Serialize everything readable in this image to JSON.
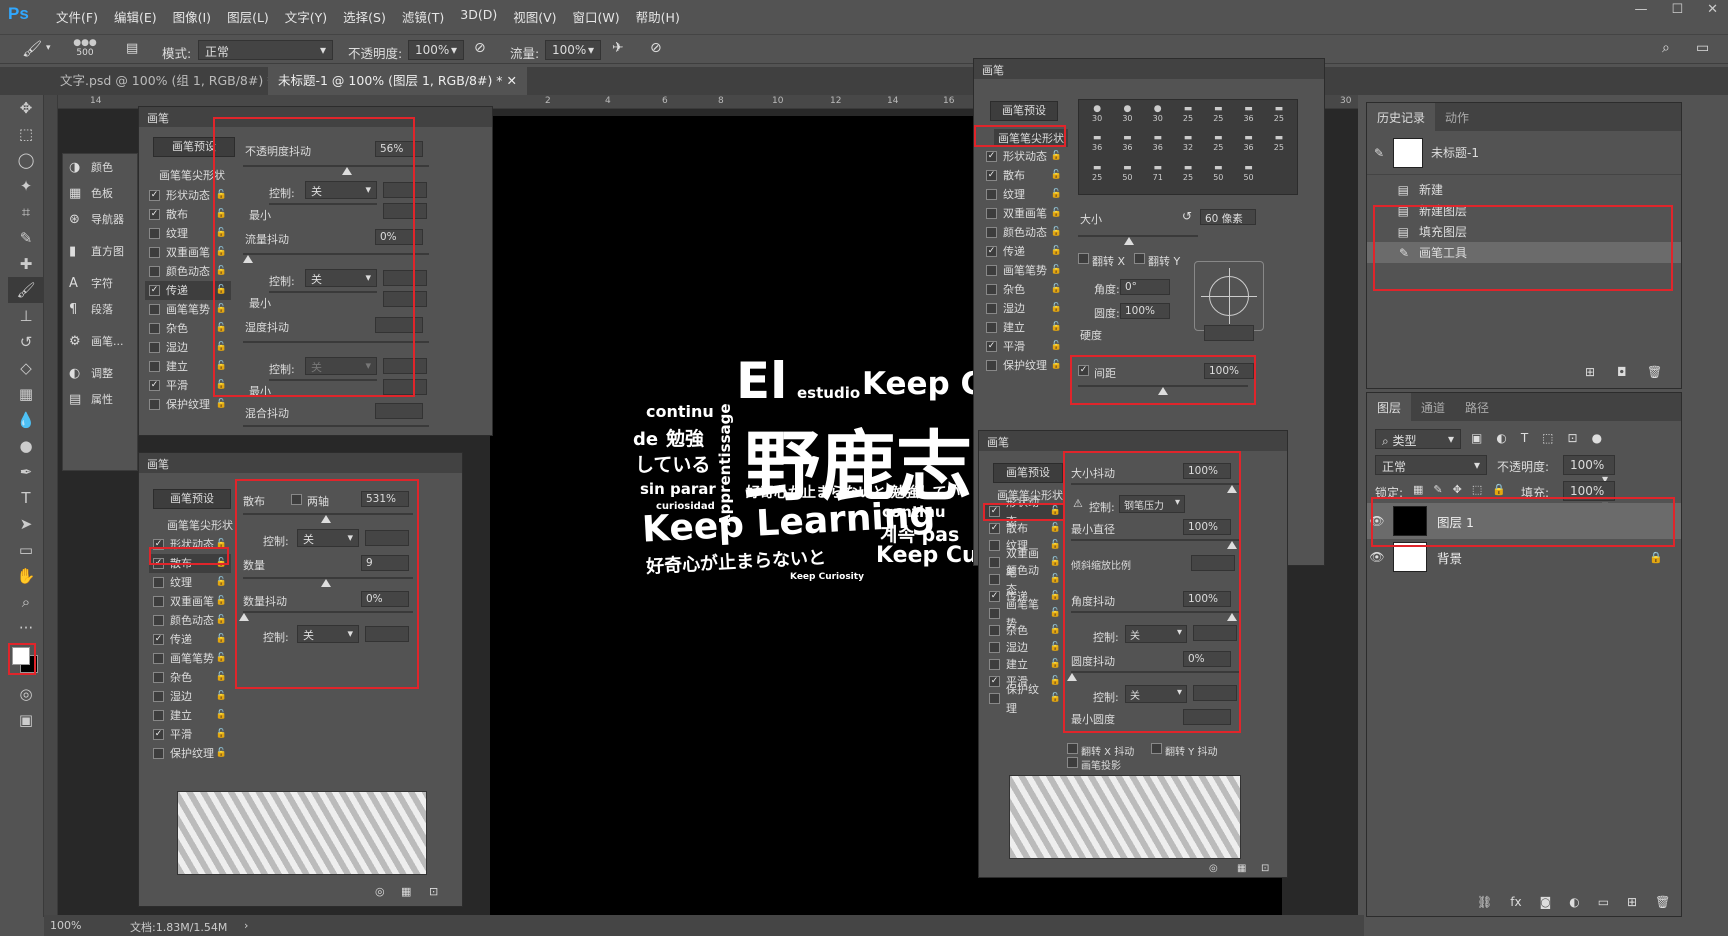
{
  "menubar": {
    "logo": "Ps",
    "items": [
      "文件(F)",
      "编辑(E)",
      "图像(I)",
      "图层(L)",
      "文字(Y)",
      "选择(S)",
      "滤镜(T)",
      "3D(D)",
      "视图(V)",
      "窗口(W)",
      "帮助(H)"
    ]
  },
  "options": {
    "brush_size": "500",
    "mode_label": "模式:",
    "mode_value": "正常",
    "opacity_label": "不透明度:",
    "opacity_value": "100%",
    "flow_label": "流量:",
    "flow_value": "100%"
  },
  "tabs": [
    {
      "label": "文字.psd @ 100% (组 1, RGB/8#) *",
      "active": false
    },
    {
      "label": "未标题-1 @ 100% (图层 1, RGB/8#) *",
      "active": true
    }
  ],
  "ruler_h": [
    "14",
    "2",
    "4",
    "6",
    "8",
    "10",
    "12",
    "14",
    "16",
    "30",
    "42"
  ],
  "ruler_v": [
    "1",
    "1",
    "1",
    "1",
    "1",
    "1",
    "2",
    "2",
    "2",
    "2",
    "2",
    "3",
    "3",
    "3"
  ],
  "mini_panels": [
    {
      "label": "颜色",
      "icon": "color-icon"
    },
    {
      "label": "色板",
      "icon": "swatches-icon"
    },
    {
      "label": "导航器",
      "icon": "navigator-icon"
    },
    {
      "label": "直方图",
      "icon": "histogram-icon"
    },
    {
      "label": "字符",
      "icon": "character-icon"
    },
    {
      "label": "段落",
      "icon": "paragraph-icon"
    },
    {
      "label": "画笔...",
      "icon": "brush-settings-icon"
    },
    {
      "label": "调整",
      "icon": "adjustments-icon"
    },
    {
      "label": "属性",
      "icon": "properties-icon"
    }
  ],
  "brush_panel": {
    "title": "画笔",
    "presets_button": "画笔预设",
    "tip_shape": "画笔笔尖形状",
    "options": [
      {
        "label": "形状动态",
        "checked": true
      },
      {
        "label": "散布",
        "checked": true
      },
      {
        "label": "纹理",
        "checked": false
      },
      {
        "label": "双重画笔",
        "checked": false
      },
      {
        "label": "颜色动态",
        "checked": false
      },
      {
        "label": "传递",
        "checked": true
      },
      {
        "label": "画笔笔势",
        "checked": false
      },
      {
        "label": "杂色",
        "checked": false
      },
      {
        "label": "湿边",
        "checked": false
      },
      {
        "label": "建立",
        "checked": false
      },
      {
        "label": "平滑",
        "checked": true
      },
      {
        "label": "保护纹理",
        "checked": false
      }
    ]
  },
  "transfer": {
    "opacity_jitter_label": "不透明度抖动",
    "opacity_jitter_value": "56%",
    "opacity_jitter_fraction": 0.56,
    "control_label": "控制:",
    "control_value": "关",
    "min_label": "最小",
    "flow_jitter_label": "流量抖动",
    "flow_jitter_value": "0%",
    "wet_jitter_label": "湿度抖动",
    "mix_jitter_label": "混合抖动"
  },
  "scatter": {
    "scatter_label": "散布",
    "both_axes_label": "两轴",
    "scatter_value": "531%",
    "control_label": "控制:",
    "control_value": "关",
    "count_label": "数量",
    "count_value": "9",
    "count_jitter_label": "数量抖动",
    "count_jitter_value": "0%"
  },
  "tip_panel": {
    "size_label": "大小",
    "size_value": "60 像素",
    "flip_x": "翻转 X",
    "flip_y": "翻转 Y",
    "angle_label": "角度:",
    "angle_value": "0°",
    "roundness_label": "圆度:",
    "roundness_value": "100%",
    "hardness_label": "硬度",
    "spacing_label": "间距",
    "spacing_value": "100%",
    "brush_sizes": [
      "30",
      "30",
      "30",
      "25",
      "25",
      "36",
      "25",
      "36",
      "36",
      "36",
      "32",
      "25",
      "36",
      "25",
      "25",
      "50",
      "71",
      "25",
      "50",
      "50"
    ]
  },
  "shape_dynamics": {
    "size_jitter_label": "大小抖动",
    "size_jitter_value": "100%",
    "control_label": "控制:",
    "control_value": "钢笔压力",
    "min_diameter_label": "最小直径",
    "min_diameter_value": "100%",
    "tilt_scale_label": "倾斜缩放比例",
    "angle_jitter_label": "角度抖动",
    "angle_jitter_value": "100%",
    "angle_control_value": "关",
    "roundness_jitter_label": "圆度抖动",
    "roundness_jitter_value": "0%",
    "roundness_control_value": "关",
    "min_roundness_label": "最小圆度",
    "flip_x_jitter": "翻转 X 抖动",
    "flip_y_jitter": "翻转 Y 抖动",
    "brush_projection": "画笔投影"
  },
  "history": {
    "tab_history": "历史记录",
    "tab_actions": "动作",
    "snapshot": "未标题-1",
    "items": [
      "新建",
      "新建图层",
      "填充图层",
      "画笔工具"
    ]
  },
  "layers": {
    "tabs": [
      "图层",
      "通道",
      "路径"
    ],
    "kind_label": "类型",
    "blend_mode": "正常",
    "opacity_label": "不透明度:",
    "opacity_value": "100%",
    "lock_label": "锁定:",
    "fill_label": "填充:",
    "fill_value": "100%",
    "items": [
      {
        "name": "图层 1",
        "selected": true
      },
      {
        "name": "背景",
        "selected": false
      }
    ]
  },
  "canvas_words": [
    "El",
    "estudio",
    "Keep Cu",
    "continu",
    "de",
    "勉強",
    "している",
    "野鹿志",
    "Apprentissage",
    "sin parar",
    "curiosidad",
    "好奇心が止まらないと 勉強してい",
    "Keep Learning",
    "continu",
    "계속 pas",
    "好奇心が止まらないと",
    "Keep Curi",
    "Keep Curiosity"
  ],
  "status": {
    "zoom": "100%",
    "doc": "文档:1.83M/1.54M"
  },
  "colors": {
    "accent_red": "#e0252b",
    "ps_blue": "#31a8ff",
    "ui_bg": "#535353"
  }
}
